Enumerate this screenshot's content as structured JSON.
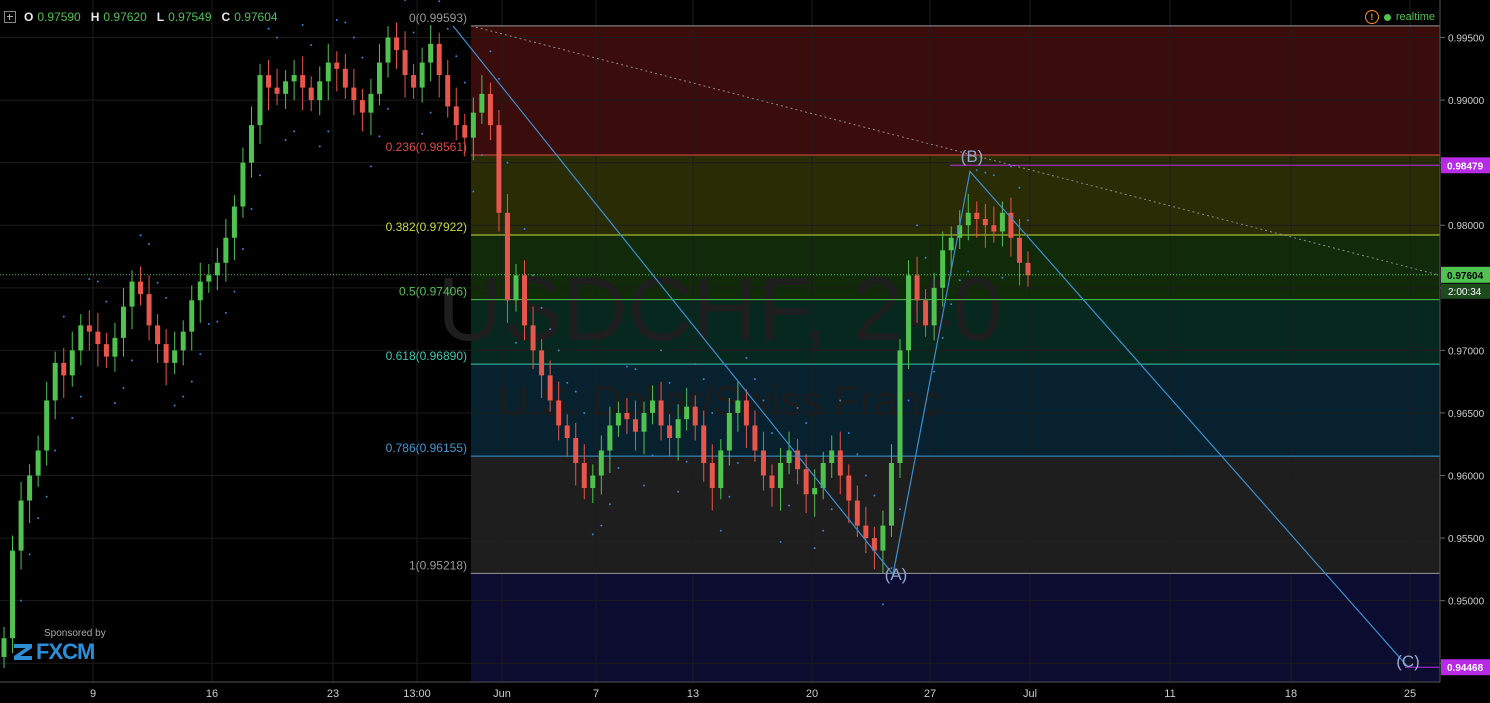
{
  "header": {
    "items": [
      {
        "label": "O",
        "value": "0.97590"
      },
      {
        "label": "H",
        "value": "0.97620"
      },
      {
        "label": "L",
        "value": "0.97549"
      },
      {
        "label": "C",
        "value": "0.97604"
      }
    ],
    "realtime_label": "realtime"
  },
  "watermark": {
    "symbol": "USDCHF, 240",
    "name": "U.S. Dollar/Swiss Franc"
  },
  "sponsor": {
    "line1": "Sponsored by",
    "brand": "FXCM"
  },
  "colors": {
    "up": "#4fc24f",
    "down": "#e8554a",
    "axis_text": "#cccccc",
    "grid": "#1c1c1c",
    "wave_line": "#3a8fd0",
    "last_price_bg": "#4fc24f",
    "marker_bg": "#b82be6"
  },
  "chart_data": {
    "type": "candlestick",
    "symbol": "USDCHF",
    "timeframe": "240",
    "y_axis": {
      "min": 0.9435,
      "max": 0.998,
      "ticks": [
        0.995,
        0.99,
        0.985,
        0.98,
        0.975,
        0.97,
        0.965,
        0.96,
        0.955,
        0.95,
        0.945
      ]
    },
    "x_axis_labels": [
      "9",
      "16",
      "23",
      "13:00",
      "Jun",
      "7",
      "13",
      "20",
      "27",
      "Jul",
      "11",
      "18",
      "25"
    ],
    "last_price": "0.97604",
    "countdown": "2:00:34",
    "price_markers": [
      {
        "label": "0.98479",
        "value": 0.98479
      },
      {
        "label": "0.94468",
        "value": 0.94468
      }
    ],
    "fib_levels": [
      {
        "ratio": "0",
        "value": 0.99593,
        "color": "#999999"
      },
      {
        "ratio": "0.236",
        "value": 0.98561,
        "color": "#e04848"
      },
      {
        "ratio": "0.382",
        "value": 0.97922,
        "color": "#c8d83a"
      },
      {
        "ratio": "0.5",
        "value": 0.97406,
        "color": "#4fc24f"
      },
      {
        "ratio": "0.618",
        "value": 0.9689,
        "color": "#3ac8b0"
      },
      {
        "ratio": "0.786",
        "value": 0.96155,
        "color": "#3a9ad8"
      },
      {
        "ratio": "1",
        "value": 0.95218,
        "color": "#999999"
      }
    ],
    "fib_zones": [
      {
        "top": 0.99593,
        "bottom": 0.98561,
        "color": "#3a0c0c"
      },
      {
        "top": 0.98561,
        "bottom": 0.97922,
        "color": "#2a2c06"
      },
      {
        "top": 0.97922,
        "bottom": 0.97406,
        "color": "#102a0a"
      },
      {
        "top": 0.97406,
        "bottom": 0.9689,
        "color": "#07281e"
      },
      {
        "top": 0.9689,
        "bottom": 0.96155,
        "color": "#07222e"
      },
      {
        "top": 0.96155,
        "bottom": 0.95218,
        "color": "#1e1e1e"
      },
      {
        "top": 0.95218,
        "bottom": 0.9435,
        "color": "#0c0c30"
      }
    ],
    "wave_labels": [
      {
        "text": "(A)",
        "value": 0.9521
      },
      {
        "text": "(B)",
        "value": 0.9848
      },
      {
        "text": "(C)",
        "value": 0.9447
      }
    ],
    "wave_path": [
      0.99593,
      0.9521,
      0.9843,
      0.9447
    ],
    "trendline": [
      0.99593,
      0.976
    ],
    "candle_closes": [
      0.947,
      0.954,
      0.958,
      0.96,
      0.962,
      0.966,
      0.969,
      0.968,
      0.97,
      0.972,
      0.9715,
      0.9705,
      0.9695,
      0.971,
      0.9735,
      0.9755,
      0.9745,
      0.972,
      0.9705,
      0.969,
      0.97,
      0.9715,
      0.974,
      0.9755,
      0.976,
      0.977,
      0.979,
      0.9815,
      0.985,
      0.988,
      0.992,
      0.991,
      0.9905,
      0.9915,
      0.992,
      0.991,
      0.99,
      0.9915,
      0.993,
      0.9925,
      0.991,
      0.99,
      0.989,
      0.9905,
      0.993,
      0.995,
      0.994,
      0.992,
      0.991,
      0.993,
      0.9945,
      0.992,
      0.9895,
      0.988,
      0.987,
      0.989,
      0.9905,
      0.988,
      0.981,
      0.974,
      0.976,
      0.972,
      0.97,
      0.968,
      0.966,
      0.964,
      0.963,
      0.961,
      0.959,
      0.96,
      0.962,
      0.964,
      0.965,
      0.9645,
      0.9635,
      0.965,
      0.966,
      0.964,
      0.963,
      0.9645,
      0.9655,
      0.964,
      0.961,
      0.959,
      0.962,
      0.965,
      0.966,
      0.964,
      0.962,
      0.96,
      0.959,
      0.961,
      0.962,
      0.9605,
      0.9585,
      0.959,
      0.961,
      0.962,
      0.96,
      0.958,
      0.956,
      0.955,
      0.954,
      0.956,
      0.961,
      0.97,
      0.976,
      0.974,
      0.972,
      0.975,
      0.978,
      0.979,
      0.98,
      0.981,
      0.9805,
      0.98,
      0.9795,
      0.981,
      0.979,
      0.977,
      0.976
    ]
  }
}
